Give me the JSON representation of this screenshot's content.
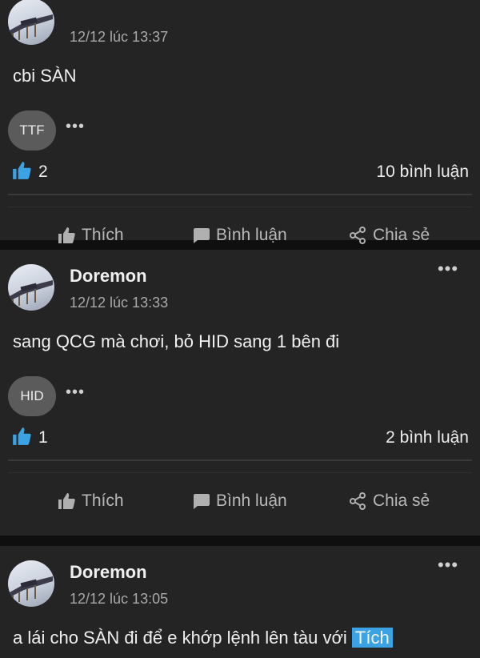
{
  "posts": [
    {
      "author": "",
      "time": "12/12 lúc 13:37",
      "content": "cbi SÀN",
      "tag": "TTF",
      "likes": "2",
      "comments": "10 bình luận"
    },
    {
      "author": "Doremon",
      "time": "12/12 lúc 13:33",
      "content": "sang QCG mà chơi, bỏ HID sang 1 bên đi",
      "tag": "HID",
      "likes": "1",
      "comments": "2 bình luận"
    },
    {
      "author": "Doremon",
      "time": "12/12 lúc 13:05",
      "content": "a lái cho SÀN đi để e khớp lệnh lên tàu với",
      "content_highlight": "Tích"
    }
  ],
  "actions": {
    "like": "Thích",
    "comment": "Bình luận",
    "share": "Chia sẻ"
  },
  "more_glyph": "•••",
  "tag_more_glyph": "•••",
  "icons": {
    "like": "thumbs-up-icon",
    "comment": "speech-bubble-icon",
    "share": "share-icon",
    "more": "more-horizontal-icon"
  },
  "colors": {
    "background": "#0f0f0f",
    "card": "#242424",
    "like_blue": "#3ba3e3",
    "tag_bg": "#5b5b5b",
    "muted_text": "#a9a9a9"
  }
}
